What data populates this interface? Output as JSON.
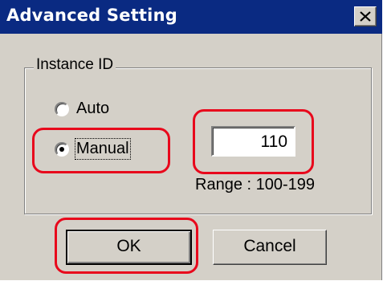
{
  "window": {
    "title": "Advanced Setting",
    "close_glyph": "✕"
  },
  "group": {
    "label": "Instance ID"
  },
  "radios": {
    "auto_label": "Auto",
    "manual_label": "Manual",
    "selected": "Manual"
  },
  "instance_id": {
    "value": "110",
    "range_text": "Range : 100-199"
  },
  "buttons": {
    "ok_label": "OK",
    "cancel_label": "Cancel"
  },
  "colors": {
    "titlebar": "#0a2a82",
    "face": "#d4d0c8",
    "highlight": "#e8081c"
  },
  "icons": [
    "close-icon",
    "radio-unselected-icon",
    "radio-selected-icon"
  ]
}
